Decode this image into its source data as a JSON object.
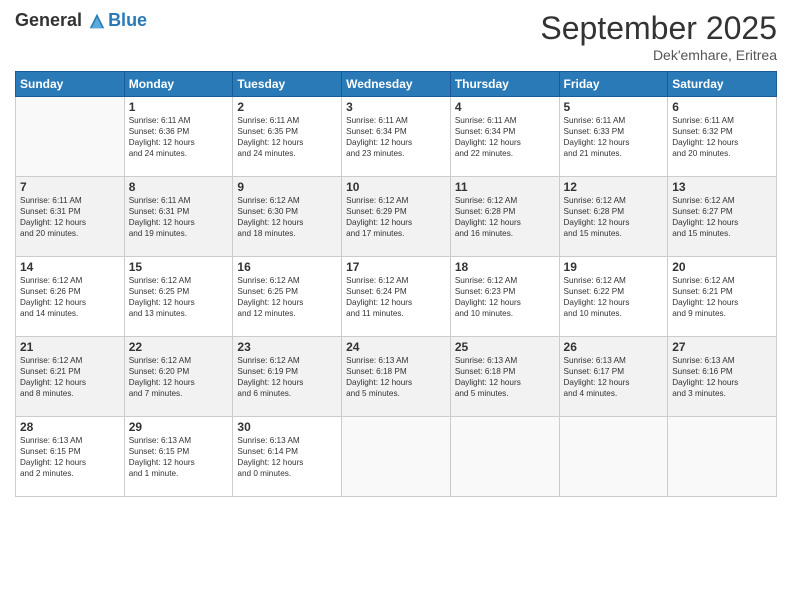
{
  "logo": {
    "line1": "General",
    "line2": "Blue"
  },
  "title": "September 2025",
  "subtitle": "Dek'emhare, Eritrea",
  "headers": [
    "Sunday",
    "Monday",
    "Tuesday",
    "Wednesday",
    "Thursday",
    "Friday",
    "Saturday"
  ],
  "weeks": [
    [
      {
        "day": "",
        "info": ""
      },
      {
        "day": "1",
        "info": "Sunrise: 6:11 AM\nSunset: 6:36 PM\nDaylight: 12 hours\nand 24 minutes."
      },
      {
        "day": "2",
        "info": "Sunrise: 6:11 AM\nSunset: 6:35 PM\nDaylight: 12 hours\nand 24 minutes."
      },
      {
        "day": "3",
        "info": "Sunrise: 6:11 AM\nSunset: 6:34 PM\nDaylight: 12 hours\nand 23 minutes."
      },
      {
        "day": "4",
        "info": "Sunrise: 6:11 AM\nSunset: 6:34 PM\nDaylight: 12 hours\nand 22 minutes."
      },
      {
        "day": "5",
        "info": "Sunrise: 6:11 AM\nSunset: 6:33 PM\nDaylight: 12 hours\nand 21 minutes."
      },
      {
        "day": "6",
        "info": "Sunrise: 6:11 AM\nSunset: 6:32 PM\nDaylight: 12 hours\nand 20 minutes."
      }
    ],
    [
      {
        "day": "7",
        "info": "Sunrise: 6:11 AM\nSunset: 6:31 PM\nDaylight: 12 hours\nand 20 minutes."
      },
      {
        "day": "8",
        "info": "Sunrise: 6:11 AM\nSunset: 6:31 PM\nDaylight: 12 hours\nand 19 minutes."
      },
      {
        "day": "9",
        "info": "Sunrise: 6:12 AM\nSunset: 6:30 PM\nDaylight: 12 hours\nand 18 minutes."
      },
      {
        "day": "10",
        "info": "Sunrise: 6:12 AM\nSunset: 6:29 PM\nDaylight: 12 hours\nand 17 minutes."
      },
      {
        "day": "11",
        "info": "Sunrise: 6:12 AM\nSunset: 6:28 PM\nDaylight: 12 hours\nand 16 minutes."
      },
      {
        "day": "12",
        "info": "Sunrise: 6:12 AM\nSunset: 6:28 PM\nDaylight: 12 hours\nand 15 minutes."
      },
      {
        "day": "13",
        "info": "Sunrise: 6:12 AM\nSunset: 6:27 PM\nDaylight: 12 hours\nand 15 minutes."
      }
    ],
    [
      {
        "day": "14",
        "info": "Sunrise: 6:12 AM\nSunset: 6:26 PM\nDaylight: 12 hours\nand 14 minutes."
      },
      {
        "day": "15",
        "info": "Sunrise: 6:12 AM\nSunset: 6:25 PM\nDaylight: 12 hours\nand 13 minutes."
      },
      {
        "day": "16",
        "info": "Sunrise: 6:12 AM\nSunset: 6:25 PM\nDaylight: 12 hours\nand 12 minutes."
      },
      {
        "day": "17",
        "info": "Sunrise: 6:12 AM\nSunset: 6:24 PM\nDaylight: 12 hours\nand 11 minutes."
      },
      {
        "day": "18",
        "info": "Sunrise: 6:12 AM\nSunset: 6:23 PM\nDaylight: 12 hours\nand 10 minutes."
      },
      {
        "day": "19",
        "info": "Sunrise: 6:12 AM\nSunset: 6:22 PM\nDaylight: 12 hours\nand 10 minutes."
      },
      {
        "day": "20",
        "info": "Sunrise: 6:12 AM\nSunset: 6:21 PM\nDaylight: 12 hours\nand 9 minutes."
      }
    ],
    [
      {
        "day": "21",
        "info": "Sunrise: 6:12 AM\nSunset: 6:21 PM\nDaylight: 12 hours\nand 8 minutes."
      },
      {
        "day": "22",
        "info": "Sunrise: 6:12 AM\nSunset: 6:20 PM\nDaylight: 12 hours\nand 7 minutes."
      },
      {
        "day": "23",
        "info": "Sunrise: 6:12 AM\nSunset: 6:19 PM\nDaylight: 12 hours\nand 6 minutes."
      },
      {
        "day": "24",
        "info": "Sunrise: 6:13 AM\nSunset: 6:18 PM\nDaylight: 12 hours\nand 5 minutes."
      },
      {
        "day": "25",
        "info": "Sunrise: 6:13 AM\nSunset: 6:18 PM\nDaylight: 12 hours\nand 5 minutes."
      },
      {
        "day": "26",
        "info": "Sunrise: 6:13 AM\nSunset: 6:17 PM\nDaylight: 12 hours\nand 4 minutes."
      },
      {
        "day": "27",
        "info": "Sunrise: 6:13 AM\nSunset: 6:16 PM\nDaylight: 12 hours\nand 3 minutes."
      }
    ],
    [
      {
        "day": "28",
        "info": "Sunrise: 6:13 AM\nSunset: 6:15 PM\nDaylight: 12 hours\nand 2 minutes."
      },
      {
        "day": "29",
        "info": "Sunrise: 6:13 AM\nSunset: 6:15 PM\nDaylight: 12 hours\nand 1 minute."
      },
      {
        "day": "30",
        "info": "Sunrise: 6:13 AM\nSunset: 6:14 PM\nDaylight: 12 hours\nand 0 minutes."
      },
      {
        "day": "",
        "info": ""
      },
      {
        "day": "",
        "info": ""
      },
      {
        "day": "",
        "info": ""
      },
      {
        "day": "",
        "info": ""
      }
    ]
  ]
}
